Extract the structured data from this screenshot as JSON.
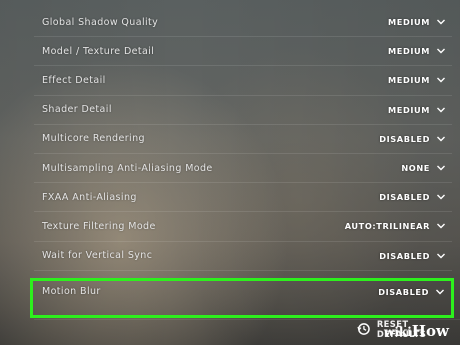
{
  "settings": [
    {
      "label": "Global Shadow Quality",
      "value": "MEDIUM"
    },
    {
      "label": "Model / Texture Detail",
      "value": "MEDIUM"
    },
    {
      "label": "Effect Detail",
      "value": "MEDIUM"
    },
    {
      "label": "Shader Detail",
      "value": "MEDIUM"
    },
    {
      "label": "Multicore Rendering",
      "value": "DISABLED"
    },
    {
      "label": "Multisampling Anti-Aliasing Mode",
      "value": "NONE"
    },
    {
      "label": "FXAA Anti-Aliasing",
      "value": "DISABLED"
    },
    {
      "label": "Texture Filtering Mode",
      "value": "AUTO:TRILINEAR"
    },
    {
      "label": "Wait for Vertical Sync",
      "value": "DISABLED"
    },
    {
      "label": "Motion Blur",
      "value": "DISABLED",
      "highlighted": true
    }
  ],
  "footer": {
    "reset_label": "RESET DEFAULTS",
    "reset_icon": "reset-clock-icon"
  },
  "watermark": {
    "part1": "wiki",
    "part2": "How"
  },
  "colors": {
    "highlight": "#2df01d",
    "text": "#e4e4e4",
    "value": "#ffffff"
  }
}
